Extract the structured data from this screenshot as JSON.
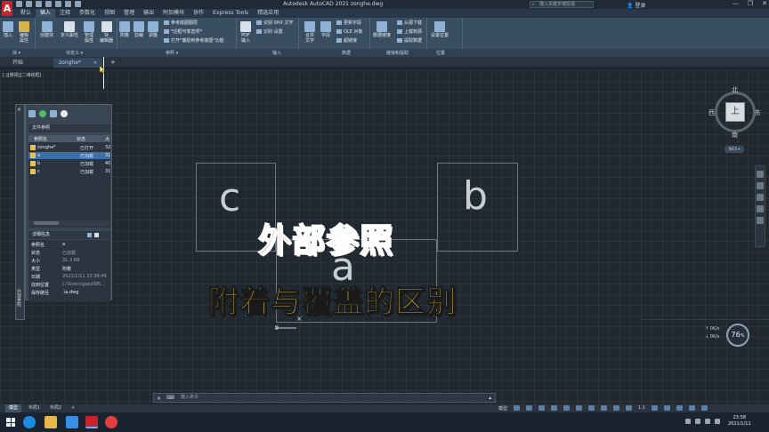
{
  "app": {
    "logo": "A",
    "title": "Autodesk AutoCAD 2021    zonghe.dwg",
    "search_placeholder": "键入关键字或短语",
    "user_label": "登录",
    "window_controls": [
      "—",
      "❐",
      "✕"
    ]
  },
  "ribbon_tabs": [
    "默认",
    "插入",
    "注释",
    "参数化",
    "视图",
    "管理",
    "输出",
    "附加模块",
    "协作",
    "Express Tools",
    "精选应用"
  ],
  "ribbon": {
    "buttons": {
      "insert": "插入",
      "edit_attr": "编辑\n属性",
      "create_block": "创建块",
      "define_attr": "定义属性",
      "manage_attr": "管理\n属性",
      "block_editor": "块\n编辑器",
      "attach": "附着",
      "clip": "剪裁",
      "adjust": "调整",
      "pdf_import": "PDF\n输入",
      "combine_text": "合并\n文字",
      "field": "字段",
      "data_link": "数据链接",
      "location": "设置位置"
    },
    "small": {
      "underlay_layers": "参考底图图层",
      "frames_vary": "*边框可变选项*",
      "snap_underlays": "打开\"捕捉到参考底图\"功能",
      "recognize_shx": "识别 SHX 文字",
      "recognize_settings": "识别 设置",
      "update_fields": "更新字段",
      "ole_object": "OLE 对象",
      "hyperlink": "超链接",
      "download_source": "从源下载",
      "upload_source": "上载到源",
      "extract_data": "提取数据"
    },
    "panel_labels": {
      "block": "块 ▾",
      "block_def": "块定义 ▾",
      "reference": "参照 ▾",
      "import": "输入",
      "data": "数据",
      "link_extract": "链接和提取",
      "location": "位置"
    }
  },
  "file_tabs": {
    "start": "开始",
    "current": "zonghe*",
    "close": "×",
    "add": "+"
  },
  "canvas": {
    "view_label": "[-][俯视][二维线框]",
    "refs": {
      "c": "c",
      "b": "b",
      "a": "a"
    },
    "ucs_x": "×"
  },
  "caption": {
    "line1": "外部参照",
    "line2": "附着与覆盖的区别"
  },
  "viewcube": {
    "north": "北",
    "south": "南",
    "east": "东",
    "west": "西",
    "face": "上",
    "wcs": "WCS ▾"
  },
  "network": {
    "speed_value": "76",
    "speed_unit": "%",
    "upload": "0K/s",
    "download": "0K/s"
  },
  "xref_palette": {
    "close": "✕",
    "vertical_title": "外部参照",
    "file_refs_title": "文件参照",
    "columns": [
      "参照名",
      "状态",
      "大"
    ],
    "rows": [
      {
        "name": "zonghe*",
        "status": "已打开",
        "size": "32"
      },
      {
        "name": "a",
        "status": "已加载",
        "size": "31"
      },
      {
        "name": "b",
        "status": "已加载",
        "size": "40"
      },
      {
        "name": "c",
        "status": "已加载",
        "size": "31"
      }
    ],
    "details_title": "详细信息",
    "details": [
      {
        "key": "参照名",
        "value": "a"
      },
      {
        "key": "状态",
        "value": "已加载"
      },
      {
        "key": "大小",
        "value": "31.3 KB"
      },
      {
        "key": "类型",
        "value": "附着"
      },
      {
        "key": "日期",
        "value": "2021/1/11 23:36:49"
      },
      {
        "key": "找到位置",
        "value": "C:\\Users\\gao168\\..."
      },
      {
        "key": "保存路径",
        "value": ".\\a.dwg"
      }
    ]
  },
  "command_line": {
    "close": "✕",
    "prompt": "键入命令",
    "arrow": "▴"
  },
  "layout_tabs": [
    "模型",
    "布局1",
    "布局2",
    "+"
  ],
  "status_bar": {
    "model_label": "模型",
    "scale": "1:1"
  },
  "taskbar": {
    "time": "23:58",
    "date": "2021/1/11"
  }
}
